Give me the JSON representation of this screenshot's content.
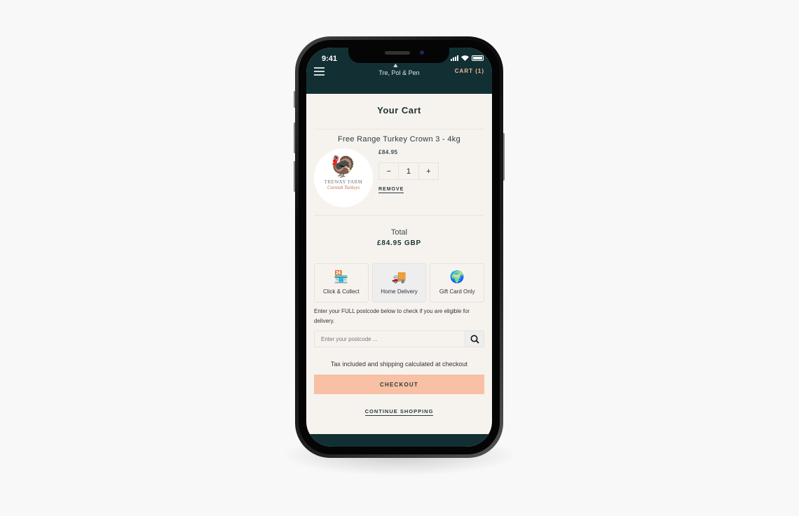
{
  "status_bar": {
    "time": "9:41"
  },
  "header": {
    "brand": "Tre, Pol & Pen",
    "logo_mark": "⛰",
    "cart_label": "CART (1)",
    "menu_icon": "hamburger-icon"
  },
  "cart": {
    "title": "Your Cart",
    "item": {
      "name": "Free Range Turkey Crown 3 - 4kg",
      "price": "£84.95",
      "quantity": "1",
      "decrement": "−",
      "increment": "+",
      "remove_label": "REMOVE",
      "image": {
        "brand_line1": "TREWAY FARM",
        "brand_line2": "Cornish Turkeys"
      }
    },
    "total_label": "Total",
    "total_value": "£84.95 GBP"
  },
  "delivery": {
    "options": [
      {
        "label": "Click & Collect",
        "icon": "shop-icon",
        "selected": false
      },
      {
        "label": "Home Delivery",
        "icon": "truck-icon",
        "selected": true
      },
      {
        "label": "Gift Card Only",
        "icon": "globe-icon",
        "selected": false
      }
    ],
    "note": "Enter your FULL postcode below to check if you are eligible for delivery.",
    "postcode_placeholder": "Enter your postcode ...",
    "postcode_value": ""
  },
  "tax_note": "Tax included and shipping calculated at checkout",
  "checkout_label": "CHECKOUT",
  "continue_label": "CONTINUE SHOPPING",
  "colors": {
    "header": "#123033",
    "accent": "#f8c0a4",
    "cart_link": "#f2b896",
    "background": "#f6f3ef"
  }
}
